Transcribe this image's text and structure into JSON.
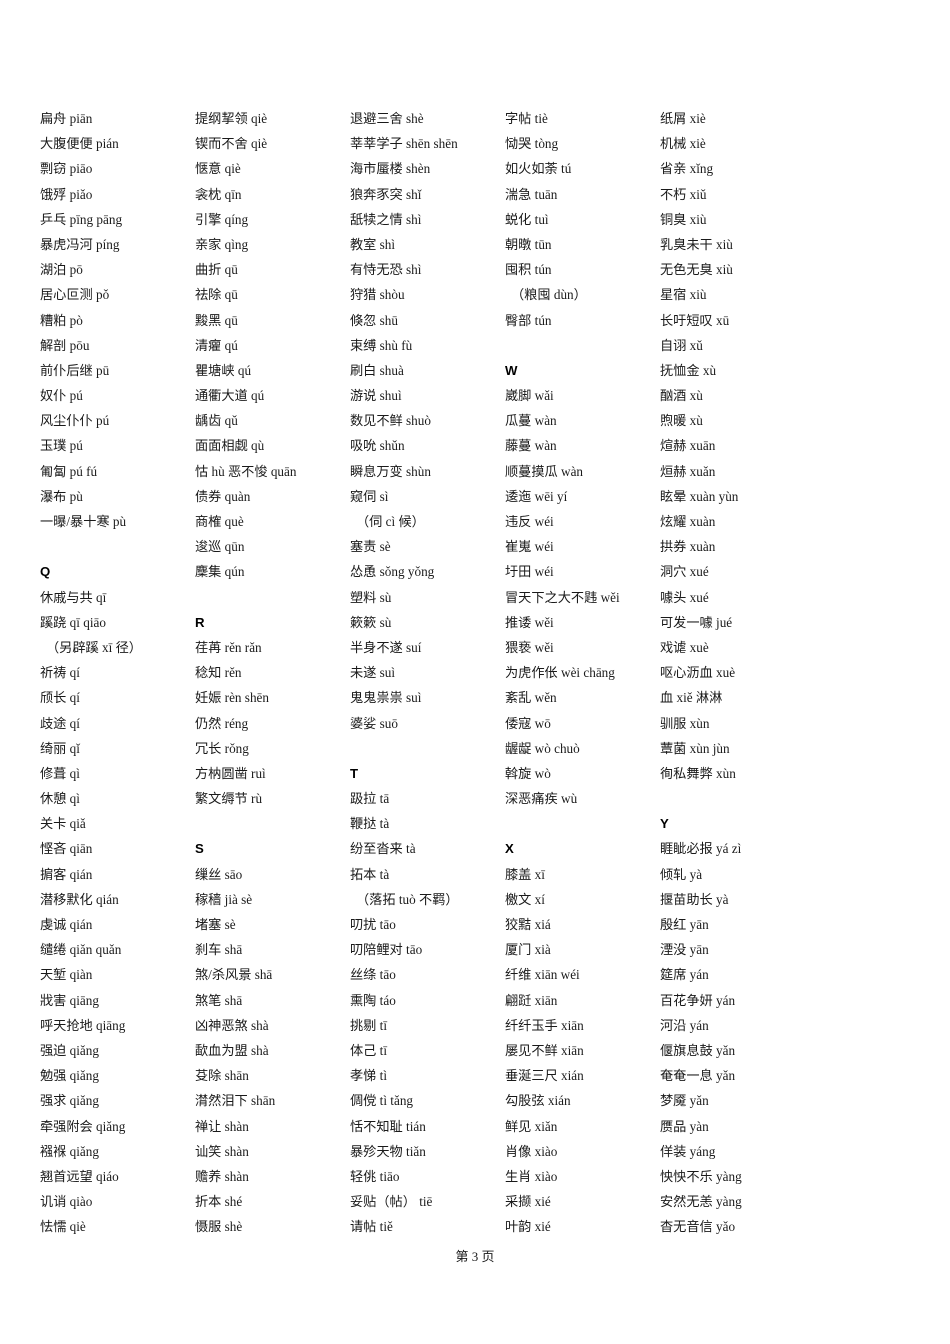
{
  "page": {
    "footer_label": "第 3 页",
    "page_number": "3"
  },
  "columns": [
    {
      "id": "column-1",
      "items": [
        {
          "type": "entry",
          "text": "扁舟 piān"
        },
        {
          "type": "entry",
          "text": "大腹便便 pián"
        },
        {
          "type": "entry",
          "text": "剽窃 piāo"
        },
        {
          "type": "entry",
          "text": "饿殍 piǎo"
        },
        {
          "type": "entry",
          "text": "乒乓 pīng pāng"
        },
        {
          "type": "entry",
          "text": "暴虎冯河 píng"
        },
        {
          "type": "entry",
          "text": "湖泊 pō"
        },
        {
          "type": "entry",
          "text": "居心叵测 pǒ"
        },
        {
          "type": "entry",
          "text": "糟粕 pò"
        },
        {
          "type": "entry",
          "text": "解剖 pōu"
        },
        {
          "type": "entry",
          "text": "前仆后继 pū"
        },
        {
          "type": "entry",
          "text": "奴仆 pú"
        },
        {
          "type": "entry",
          "text": "风尘仆仆 pú"
        },
        {
          "type": "entry",
          "text": "玉璞 pú"
        },
        {
          "type": "entry",
          "text": "匍匐 pú fú"
        },
        {
          "type": "entry",
          "text": "瀑布 pù"
        },
        {
          "type": "entry",
          "text": "一曝/暴十寒 pù"
        },
        {
          "type": "blank",
          "text": ""
        },
        {
          "type": "letter",
          "text": "Q"
        },
        {
          "type": "entry",
          "text": "休戚与共 qī"
        },
        {
          "type": "entry",
          "text": "蹊跷 qī qiāo"
        },
        {
          "type": "entry",
          "indent": true,
          "text": "（另辟蹊 xī 径）"
        },
        {
          "type": "entry",
          "text": "祈祷 qí"
        },
        {
          "type": "entry",
          "text": "颀长 qí"
        },
        {
          "type": "entry",
          "text": "歧途 qí"
        },
        {
          "type": "entry",
          "text": "绮丽 qǐ"
        },
        {
          "type": "entry",
          "text": "修葺 qì"
        },
        {
          "type": "entry",
          "text": "休憩 qì"
        },
        {
          "type": "entry",
          "text": "关卡 qiǎ"
        },
        {
          "type": "entry",
          "text": "悭吝 qiān"
        },
        {
          "type": "entry",
          "text": "掮客 qián"
        },
        {
          "type": "entry",
          "text": "潜移默化 qián"
        },
        {
          "type": "entry",
          "text": "虔诚 qián"
        },
        {
          "type": "entry",
          "text": "缱绻 qiǎn quǎn"
        },
        {
          "type": "entry",
          "text": "天堑 qiàn"
        },
        {
          "type": "entry",
          "text": "戕害 qiāng"
        },
        {
          "type": "entry",
          "text": "呼天抢地 qiāng"
        },
        {
          "type": "entry",
          "text": "强迫 qiǎng"
        },
        {
          "type": "entry",
          "text": "勉强 qiǎng"
        },
        {
          "type": "entry",
          "text": "强求 qiǎng"
        },
        {
          "type": "entry",
          "text": "牵强附会 qiǎng"
        },
        {
          "type": "entry",
          "text": "襁褓 qiǎng"
        },
        {
          "type": "entry",
          "text": "翘首远望 qiáo"
        },
        {
          "type": "entry",
          "text": "讥诮 qiào"
        },
        {
          "type": "entry",
          "text": "怯懦 qiè"
        }
      ]
    },
    {
      "id": "column-2",
      "items": [
        {
          "type": "entry",
          "text": "提纲挈领 qiè"
        },
        {
          "type": "entry",
          "text": "锲而不舍 qiè"
        },
        {
          "type": "entry",
          "text": "惬意 qiè"
        },
        {
          "type": "entry",
          "text": "衾枕 qīn"
        },
        {
          "type": "entry",
          "text": "引擎 qíng"
        },
        {
          "type": "entry",
          "text": "亲家 qìng"
        },
        {
          "type": "entry",
          "text": "曲折 qū"
        },
        {
          "type": "entry",
          "text": "祛除 qū"
        },
        {
          "type": "entry",
          "text": "黢黑 qū"
        },
        {
          "type": "entry",
          "text": "清癯 qú"
        },
        {
          "type": "entry",
          "text": "瞿塘峡 qú"
        },
        {
          "type": "entry",
          "text": "通衢大道 qú"
        },
        {
          "type": "entry",
          "text": "龋齿 qǔ"
        },
        {
          "type": "entry",
          "text": "面面相觑 qù"
        },
        {
          "type": "entry",
          "text": "怙 hù 恶不悛 quān"
        },
        {
          "type": "entry",
          "text": "债券 quàn"
        },
        {
          "type": "entry",
          "text": "商榷 què"
        },
        {
          "type": "entry",
          "text": "逡巡 qūn"
        },
        {
          "type": "entry",
          "text": "麇集 qún"
        },
        {
          "type": "blank",
          "text": ""
        },
        {
          "type": "letter",
          "text": "R"
        },
        {
          "type": "entry",
          "text": "荏苒 rěn rǎn"
        },
        {
          "type": "entry",
          "text": "稔知 rěn"
        },
        {
          "type": "entry",
          "text": "妊娠 rèn shēn"
        },
        {
          "type": "entry",
          "text": "仍然 réng"
        },
        {
          "type": "entry",
          "text": "冗长 rǒng"
        },
        {
          "type": "entry",
          "text": "方枘圆凿 ruì"
        },
        {
          "type": "entry",
          "text": "繁文缛节 rù"
        },
        {
          "type": "blank",
          "text": ""
        },
        {
          "type": "letter",
          "text": "S"
        },
        {
          "type": "entry",
          "text": "缫丝 sāo"
        },
        {
          "type": "entry",
          "text": "稼穑 jià sè"
        },
        {
          "type": "entry",
          "text": "堵塞 sè"
        },
        {
          "type": "entry",
          "text": "刹车 shā"
        },
        {
          "type": "entry",
          "text": "煞/杀风景 shā"
        },
        {
          "type": "entry",
          "text": "煞笔 shā"
        },
        {
          "type": "entry",
          "text": "凶神恶煞 shà"
        },
        {
          "type": "entry",
          "text": "歃血为盟 shà"
        },
        {
          "type": "entry",
          "text": "芟除 shān"
        },
        {
          "type": "entry",
          "text": "潸然泪下 shān"
        },
        {
          "type": "entry",
          "text": "禅让 shàn"
        },
        {
          "type": "entry",
          "text": "讪笑 shàn"
        },
        {
          "type": "entry",
          "text": "赡养 shàn"
        },
        {
          "type": "entry",
          "text": "折本 shé"
        },
        {
          "type": "entry",
          "text": "慑服 shè"
        }
      ]
    },
    {
      "id": "column-3",
      "items": [
        {
          "type": "entry",
          "text": "退避三舍 shè"
        },
        {
          "type": "entry",
          "text": "莘莘学子 shēn shēn"
        },
        {
          "type": "entry",
          "text": "海市蜃楼 shèn"
        },
        {
          "type": "entry",
          "text": "狼奔豕突 shǐ"
        },
        {
          "type": "entry",
          "text": "舐犊之情 shì"
        },
        {
          "type": "entry",
          "text": "教室 shì"
        },
        {
          "type": "entry",
          "text": "有恃无恐 shì"
        },
        {
          "type": "entry",
          "text": "狩猎 shòu"
        },
        {
          "type": "entry",
          "text": "倏忽 shū"
        },
        {
          "type": "entry",
          "text": "束缚 shù fù"
        },
        {
          "type": "entry",
          "text": "刷白 shuà"
        },
        {
          "type": "entry",
          "text": "游说 shuì"
        },
        {
          "type": "entry",
          "text": "数见不鲜 shuò"
        },
        {
          "type": "entry",
          "text": "吸吮 shǔn"
        },
        {
          "type": "entry",
          "text": "瞬息万变 shùn"
        },
        {
          "type": "entry",
          "text": "窥伺 sì"
        },
        {
          "type": "entry",
          "indent": true,
          "text": "（伺 cì 候）"
        },
        {
          "type": "entry",
          "text": "塞责 sè"
        },
        {
          "type": "entry",
          "text": "怂恿 sǒng yǒng"
        },
        {
          "type": "entry",
          "text": "塑料 sù"
        },
        {
          "type": "entry",
          "text": "簌簌 sù"
        },
        {
          "type": "entry",
          "text": "半身不遂 suí"
        },
        {
          "type": "entry",
          "text": "未遂 suì"
        },
        {
          "type": "entry",
          "text": "鬼鬼祟祟 suì"
        },
        {
          "type": "entry",
          "text": "婆娑 suō"
        },
        {
          "type": "blank",
          "text": ""
        },
        {
          "type": "letter",
          "text": "T"
        },
        {
          "type": "entry",
          "text": "趿拉 tā"
        },
        {
          "type": "entry",
          "text": "鞭挞 tà"
        },
        {
          "type": "entry",
          "text": "纷至沓来 tà"
        },
        {
          "type": "entry",
          "text": "拓本 tà"
        },
        {
          "type": "entry",
          "indent": true,
          "text": "（落拓 tuò 不羁）"
        },
        {
          "type": "entry",
          "text": "叨扰 tāo"
        },
        {
          "type": "entry",
          "text": "叨陪鲤对 tāo"
        },
        {
          "type": "entry",
          "text": "丝绦 tāo"
        },
        {
          "type": "entry",
          "text": "熏陶 táo"
        },
        {
          "type": "entry",
          "text": "挑剔 tī"
        },
        {
          "type": "entry",
          "text": "体己 tī"
        },
        {
          "type": "entry",
          "text": "孝悌 tì"
        },
        {
          "type": "entry",
          "text": "倜傥 tì tǎng"
        },
        {
          "type": "entry",
          "text": "恬不知耻 tián"
        },
        {
          "type": "entry",
          "text": "暴殄天物 tiǎn"
        },
        {
          "type": "entry",
          "text": "轻佻 tiāo"
        },
        {
          "type": "entry",
          "text": "妥贴（帖） tiē"
        },
        {
          "type": "entry",
          "text": "请帖 tiě"
        }
      ]
    },
    {
      "id": "column-4",
      "items": [
        {
          "type": "entry",
          "text": "字帖 tiè"
        },
        {
          "type": "entry",
          "text": "恸哭 tòng"
        },
        {
          "type": "entry",
          "text": "如火如荼 tú"
        },
        {
          "type": "entry",
          "text": "湍急 tuān"
        },
        {
          "type": "entry",
          "text": "蜕化 tuì"
        },
        {
          "type": "entry",
          "text": "朝暾 tūn"
        },
        {
          "type": "entry",
          "text": "囤积 tún"
        },
        {
          "type": "entry",
          "indent": true,
          "text": "（粮囤 dùn）"
        },
        {
          "type": "entry",
          "text": "臀部 tún"
        },
        {
          "type": "blank",
          "text": ""
        },
        {
          "type": "letter",
          "text": "W"
        },
        {
          "type": "entry",
          "text": "崴脚 wǎi"
        },
        {
          "type": "entry",
          "text": "瓜蔓 wàn"
        },
        {
          "type": "entry",
          "text": "藤蔓 wàn"
        },
        {
          "type": "entry",
          "text": "顺蔓摸瓜 wàn"
        },
        {
          "type": "entry",
          "text": "逶迤 wēi yí"
        },
        {
          "type": "entry",
          "text": "违反 wéi"
        },
        {
          "type": "entry",
          "text": "崔嵬 wéi"
        },
        {
          "type": "entry",
          "text": "圩田 wéi"
        },
        {
          "type": "entry",
          "text": "冒天下之大不韪 wěi"
        },
        {
          "type": "entry",
          "text": "推诿 wěi"
        },
        {
          "type": "entry",
          "text": "猥亵 wěi"
        },
        {
          "type": "entry",
          "text": "为虎作伥 wèi chāng"
        },
        {
          "type": "entry",
          "text": "紊乱 wěn"
        },
        {
          "type": "entry",
          "text": "倭寇 wō"
        },
        {
          "type": "entry",
          "text": "龌龊 wò chuò"
        },
        {
          "type": "entry",
          "text": "斡旋 wò"
        },
        {
          "type": "entry",
          "text": "深恶痛疾 wù"
        },
        {
          "type": "blank",
          "text": ""
        },
        {
          "type": "letter",
          "text": "X"
        },
        {
          "type": "entry",
          "text": "膝盖 xī"
        },
        {
          "type": "entry",
          "text": "檄文 xí"
        },
        {
          "type": "entry",
          "text": "狡黠 xiá"
        },
        {
          "type": "entry",
          "text": "厦门 xià"
        },
        {
          "type": "entry",
          "text": "纤维 xiān wéi"
        },
        {
          "type": "entry",
          "text": "翩跹 xiān"
        },
        {
          "type": "entry",
          "text": "纤纤玉手 xiān"
        },
        {
          "type": "entry",
          "text": "屡见不鲜 xiān"
        },
        {
          "type": "entry",
          "text": "垂涎三尺 xián"
        },
        {
          "type": "entry",
          "text": "勾股弦 xián"
        },
        {
          "type": "entry",
          "text": "鲜见 xiǎn"
        },
        {
          "type": "entry",
          "text": "肖像 xiào"
        },
        {
          "type": "entry",
          "text": "生肖 xiào"
        },
        {
          "type": "entry",
          "text": "采撷 xié"
        },
        {
          "type": "entry",
          "text": "叶韵 xié"
        }
      ]
    },
    {
      "id": "column-5",
      "items": [
        {
          "type": "entry",
          "text": "纸屑 xiè"
        },
        {
          "type": "entry",
          "text": "机械 xiè"
        },
        {
          "type": "entry",
          "text": "省亲 xǐng"
        },
        {
          "type": "entry",
          "text": "不朽 xiǔ"
        },
        {
          "type": "entry",
          "text": "铜臭 xiù"
        },
        {
          "type": "entry",
          "text": "乳臭未干 xiù"
        },
        {
          "type": "entry",
          "text": "无色无臭 xiù"
        },
        {
          "type": "entry",
          "text": "星宿 xiù"
        },
        {
          "type": "entry",
          "text": "长吁短叹 xū"
        },
        {
          "type": "entry",
          "text": "自诩 xǔ"
        },
        {
          "type": "entry",
          "text": "抚恤金 xù"
        },
        {
          "type": "entry",
          "text": "酗酒 xù"
        },
        {
          "type": "entry",
          "text": "煦暖 xù"
        },
        {
          "type": "entry",
          "text": "煊赫 xuān"
        },
        {
          "type": "entry",
          "text": "烜赫 xuǎn"
        },
        {
          "type": "entry",
          "text": "眩晕 xuàn yùn"
        },
        {
          "type": "entry",
          "text": "炫耀 xuàn"
        },
        {
          "type": "entry",
          "text": "拱券 xuàn"
        },
        {
          "type": "entry",
          "text": "洞穴 xué"
        },
        {
          "type": "entry",
          "text": "噱头 xué"
        },
        {
          "type": "entry",
          "text": "可发一噱 jué"
        },
        {
          "type": "entry",
          "text": "戏谑 xuè"
        },
        {
          "type": "entry",
          "text": "呕心沥血 xuè"
        },
        {
          "type": "entry",
          "text": "血 xiě 淋淋"
        },
        {
          "type": "entry",
          "text": "驯服 xùn"
        },
        {
          "type": "entry",
          "text": "蕈菌 xùn jùn"
        },
        {
          "type": "entry",
          "text": "徇私舞弊 xùn"
        },
        {
          "type": "blank",
          "text": ""
        },
        {
          "type": "letter",
          "text": "Y"
        },
        {
          "type": "entry",
          "text": "睚眦必报 yá zì"
        },
        {
          "type": "entry",
          "text": "倾轧 yà"
        },
        {
          "type": "entry",
          "text": "揠苗助长 yà"
        },
        {
          "type": "entry",
          "text": "殷红 yān"
        },
        {
          "type": "entry",
          "text": "湮没 yān"
        },
        {
          "type": "entry",
          "text": "筵席 yán"
        },
        {
          "type": "entry",
          "text": "百花争妍 yán"
        },
        {
          "type": "entry",
          "text": "河沿 yán"
        },
        {
          "type": "entry",
          "text": "偃旗息鼓 yǎn"
        },
        {
          "type": "entry",
          "text": "奄奄一息 yǎn"
        },
        {
          "type": "entry",
          "text": "梦魇 yǎn"
        },
        {
          "type": "entry",
          "text": "赝品 yàn"
        },
        {
          "type": "entry",
          "text": "佯装 yáng"
        },
        {
          "type": "entry",
          "text": "怏怏不乐 yàng"
        },
        {
          "type": "entry",
          "text": "安然无恙 yàng"
        },
        {
          "type": "entry",
          "text": "杳无音信 yǎo"
        }
      ]
    }
  ]
}
